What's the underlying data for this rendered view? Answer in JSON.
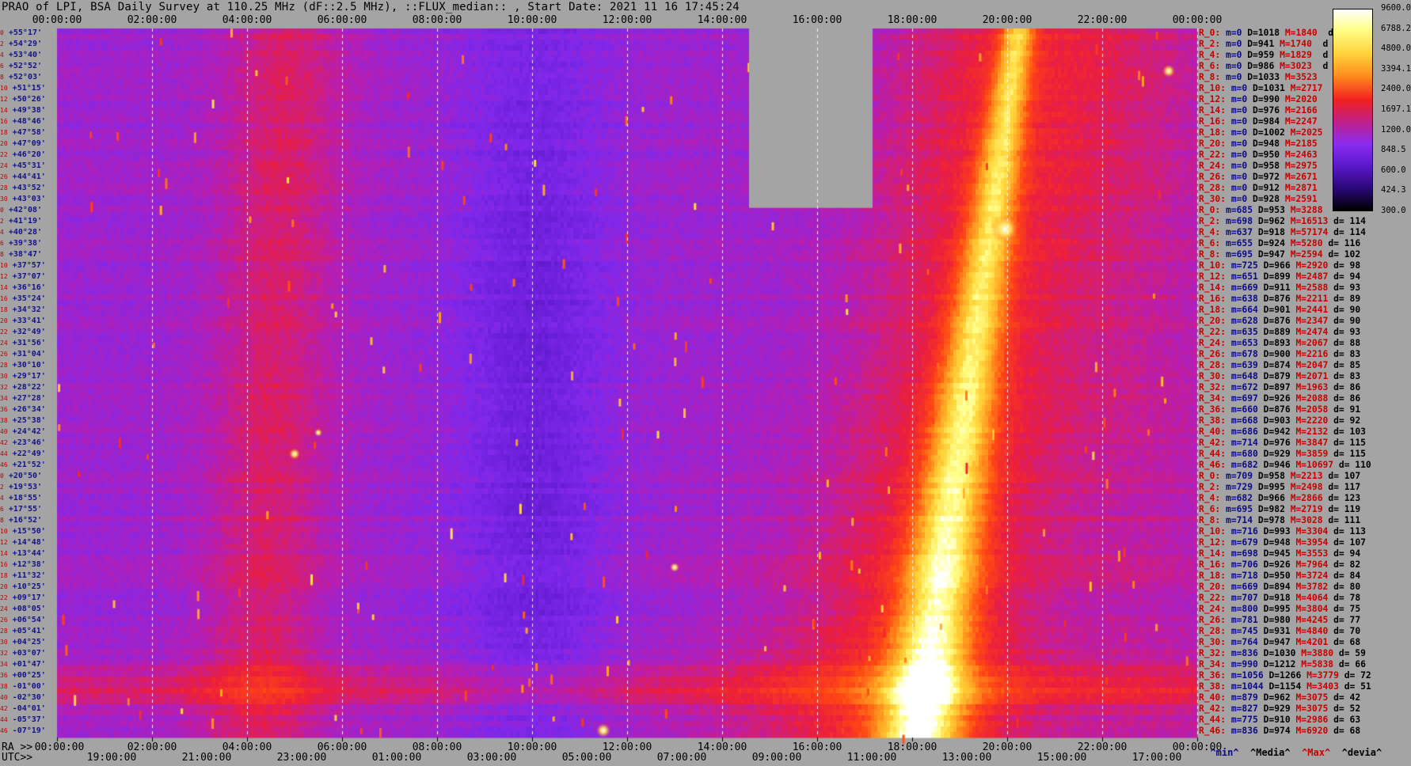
{
  "title": "PRAO of LPI, BSA Daily Survey at 110.25 MHz (dF::2.5 MHz), ::FLUX_median:: , Start Date: 2021 11 16 17:45:24",
  "axis": {
    "top_ticks": [
      "00:00:00",
      "02:00:00",
      "04:00:00",
      "06:00:00",
      "08:00:00",
      "10:00:00",
      "12:00:00",
      "14:00:00",
      "16:00:00",
      "18:00:00",
      "20:00:00",
      "22:00:00",
      "00:00:00"
    ],
    "bottom_ra_prefix": "RA >>",
    "bottom_ra_ticks": [
      "00:00:00",
      "02:00:00",
      "04:00:00",
      "06:00:00",
      "08:00:00",
      "10:00:00",
      "12:00:00",
      "14:00:00",
      "16:00:00",
      "18:00:00",
      "20:00:00",
      "22:00:00",
      "00:00:00"
    ],
    "bottom_utc_prefix": "UTC>>",
    "bottom_utc_ticks": [
      "19:00:00",
      "21:00:00",
      "23:00:00",
      "01:00:00",
      "03:00:00",
      "05:00:00",
      "07:00:00",
      "09:00:00",
      "11:00:00",
      "13:00:00",
      "15:00:00",
      "17:00:00"
    ]
  },
  "declinations": [
    "+55°17'",
    "+54°29'",
    "+53°40'",
    "+52°52'",
    "+52°03'",
    "+51°15'",
    "+50°26'",
    "+49°38'",
    "+48°46'",
    "+47°58'",
    "+47°09'",
    "+46°20'",
    "+45°31'",
    "+44°41'",
    "+43°52'",
    "+43°03'",
    "+42°08'",
    "+41°19'",
    "+40°28'",
    "+39°38'",
    "+38°47'",
    "+37°57'",
    "+37°07'",
    "+36°16'",
    "+35°24'",
    "+34°32'",
    "+33°41'",
    "+32°49'",
    "+31°56'",
    "+31°04'",
    "+30°10'",
    "+29°17'",
    "+28°22'",
    "+27°28'",
    "+26°34'",
    "+25°38'",
    "+24°42'",
    "+23°46'",
    "+22°49'",
    "+21°52'",
    "+20°50'",
    "+19°53'",
    "+18°55'",
    "+17°55'",
    "+16°52'",
    "+15°50'",
    "+14°48'",
    "+13°44'",
    "+12°38'",
    "+11°32'",
    "+10°25'",
    "+09°17'",
    "+08°05'",
    "+06°54'",
    "+05°41'",
    "+04°25'",
    "+03°07'",
    "+01°47'",
    "+00°25'",
    "-01°00'",
    "-02°30'",
    "-04°01'",
    "-05°37'",
    "-07°19'"
  ],
  "dec_index": [
    "0",
    "2",
    "4",
    "6",
    "8",
    "10",
    "12",
    "14",
    "16",
    "18",
    "20",
    "22",
    "24",
    "26",
    "28",
    "30",
    "0",
    "2",
    "4",
    "6",
    "8",
    "10",
    "12",
    "14",
    "16",
    "18",
    "20",
    "22",
    "24",
    "26",
    "28",
    "30",
    "32",
    "34",
    "36",
    "38",
    "40",
    "42",
    "44",
    "46",
    "0",
    "2",
    "4",
    "6",
    "8",
    "10",
    "12",
    "14",
    "16",
    "18",
    "20",
    "22",
    "24",
    "26",
    "28",
    "30",
    "32",
    "34",
    "36",
    "38",
    "40",
    "42",
    "44",
    "46"
  ],
  "stats": [
    {
      "r": "R_0:",
      "m": "m=0",
      "d": "D=1018",
      "mx": "M=1840",
      "dv": " d"
    },
    {
      "r": "R_2:",
      "m": "m=0",
      "d": "D=941",
      "mx": "M=1740",
      "dv": " d"
    },
    {
      "r": "R_4:",
      "m": "m=0",
      "d": "D=959",
      "mx": "M=1829",
      "dv": " d"
    },
    {
      "r": "R_6:",
      "m": "m=0",
      "d": "D=986",
      "mx": "M=3023",
      "dv": " d"
    },
    {
      "r": "R_8:",
      "m": "m=0",
      "d": "D=1033",
      "mx": "M=3523",
      "dv": ""
    },
    {
      "r": "R_10:",
      "m": "m=0",
      "d": "D=1031",
      "mx": "M=2717",
      "dv": ""
    },
    {
      "r": "R_12:",
      "m": "m=0",
      "d": "D=990",
      "mx": "M=2020",
      "dv": ""
    },
    {
      "r": "R_14:",
      "m": "m=0",
      "d": "D=976",
      "mx": "M=2166",
      "dv": ""
    },
    {
      "r": "R_16:",
      "m": "m=0",
      "d": "D=984",
      "mx": "M=2247",
      "dv": ""
    },
    {
      "r": "R_18:",
      "m": "m=0",
      "d": "D=1002",
      "mx": "M=2025",
      "dv": ""
    },
    {
      "r": "R_20:",
      "m": "m=0",
      "d": "D=948",
      "mx": "M=2185",
      "dv": ""
    },
    {
      "r": "R_22:",
      "m": "m=0",
      "d": "D=950",
      "mx": "M=2463",
      "dv": ""
    },
    {
      "r": "R_24:",
      "m": "m=0",
      "d": "D=958",
      "mx": "M=2975",
      "dv": ""
    },
    {
      "r": "R_26:",
      "m": "m=0",
      "d": "D=972",
      "mx": "M=2671",
      "dv": ""
    },
    {
      "r": "R_28:",
      "m": "m=0",
      "d": "D=912",
      "mx": "M=2871",
      "dv": ""
    },
    {
      "r": "R_30:",
      "m": "m=0",
      "d": "D=928",
      "mx": "M=2591",
      "dv": ""
    },
    {
      "r": "R_0:",
      "m": "m=685",
      "d": "D=953",
      "mx": "M=3288",
      "dv": ""
    },
    {
      "r": "R_2:",
      "m": "m=698",
      "d": "D=962",
      "mx": "M=16513",
      "dv": "d= 114"
    },
    {
      "r": "R_4:",
      "m": "m=637",
      "d": "D=918",
      "mx": "M=57174",
      "dv": "d= 114"
    },
    {
      "r": "R_6:",
      "m": "m=655",
      "d": "D=924",
      "mx": "M=5280",
      "dv": "d= 116"
    },
    {
      "r": "R_8:",
      "m": "m=695",
      "d": "D=947",
      "mx": "M=2594",
      "dv": "d= 102"
    },
    {
      "r": "R_10:",
      "m": "m=725",
      "d": "D=966",
      "mx": "M=2920",
      "dv": "d= 98"
    },
    {
      "r": "R_12:",
      "m": "m=651",
      "d": "D=899",
      "mx": "M=2487",
      "dv": "d= 94"
    },
    {
      "r": "R_14:",
      "m": "m=669",
      "d": "D=911",
      "mx": "M=2588",
      "dv": "d= 93"
    },
    {
      "r": "R_16:",
      "m": "m=638",
      "d": "D=876",
      "mx": "M=2211",
      "dv": "d= 89"
    },
    {
      "r": "R_18:",
      "m": "m=664",
      "d": "D=901",
      "mx": "M=2441",
      "dv": "d= 90"
    },
    {
      "r": "R_20:",
      "m": "m=628",
      "d": "D=876",
      "mx": "M=2347",
      "dv": "d= 90"
    },
    {
      "r": "R_22:",
      "m": "m=635",
      "d": "D=889",
      "mx": "M=2474",
      "dv": "d= 93"
    },
    {
      "r": "R_24:",
      "m": "m=653",
      "d": "D=893",
      "mx": "M=2067",
      "dv": "d= 88"
    },
    {
      "r": "R_26:",
      "m": "m=678",
      "d": "D=900",
      "mx": "M=2216",
      "dv": "d= 83"
    },
    {
      "r": "R_28:",
      "m": "m=639",
      "d": "D=874",
      "mx": "M=2047",
      "dv": "d= 85"
    },
    {
      "r": "R_30:",
      "m": "m=648",
      "d": "D=879",
      "mx": "M=2071",
      "dv": "d= 83"
    },
    {
      "r": "R_32:",
      "m": "m=672",
      "d": "D=897",
      "mx": "M=1963",
      "dv": "d= 86"
    },
    {
      "r": "R_34:",
      "m": "m=697",
      "d": "D=926",
      "mx": "M=2088",
      "dv": "d= 86"
    },
    {
      "r": "R_36:",
      "m": "m=660",
      "d": "D=876",
      "mx": "M=2058",
      "dv": "d= 91"
    },
    {
      "r": "R_38:",
      "m": "m=668",
      "d": "D=903",
      "mx": "M=2220",
      "dv": "d= 92"
    },
    {
      "r": "R_40:",
      "m": "m=686",
      "d": "D=942",
      "mx": "M=2132",
      "dv": "d= 103"
    },
    {
      "r": "R_42:",
      "m": "m=714",
      "d": "D=976",
      "mx": "M=3847",
      "dv": "d= 115"
    },
    {
      "r": "R_44:",
      "m": "m=680",
      "d": "D=929",
      "mx": "M=3859",
      "dv": "d= 115"
    },
    {
      "r": "R_46:",
      "m": "m=682",
      "d": "D=946",
      "mx": "M=10697",
      "dv": "d= 110"
    },
    {
      "r": "R_0:",
      "m": "m=709",
      "d": "D=958",
      "mx": "M=2213",
      "dv": "d= 107"
    },
    {
      "r": "R_2:",
      "m": "m=729",
      "d": "D=995",
      "mx": "M=2498",
      "dv": "d= 117"
    },
    {
      "r": "R_4:",
      "m": "m=682",
      "d": "D=966",
      "mx": "M=2866",
      "dv": "d= 123"
    },
    {
      "r": "R_6:",
      "m": "m=695",
      "d": "D=982",
      "mx": "M=2719",
      "dv": "d= 119"
    },
    {
      "r": "R_8:",
      "m": "m=714",
      "d": "D=978",
      "mx": "M=3028",
      "dv": "d= 111"
    },
    {
      "r": "R_10:",
      "m": "m=716",
      "d": "D=993",
      "mx": "M=3304",
      "dv": "d= 113"
    },
    {
      "r": "R_12:",
      "m": "m=679",
      "d": "D=948",
      "mx": "M=3954",
      "dv": "d= 107"
    },
    {
      "r": "R_14:",
      "m": "m=698",
      "d": "D=945",
      "mx": "M=3553",
      "dv": "d= 94"
    },
    {
      "r": "R_16:",
      "m": "m=706",
      "d": "D=926",
      "mx": "M=7964",
      "dv": "d= 82"
    },
    {
      "r": "R_18:",
      "m": "m=718",
      "d": "D=950",
      "mx": "M=3724",
      "dv": "d= 84"
    },
    {
      "r": "R_20:",
      "m": "m=669",
      "d": "D=894",
      "mx": "M=3782",
      "dv": "d= 80"
    },
    {
      "r": "R_22:",
      "m": "m=707",
      "d": "D=918",
      "mx": "M=4064",
      "dv": "d= 78"
    },
    {
      "r": "R_24:",
      "m": "m=800",
      "d": "D=995",
      "mx": "M=3804",
      "dv": "d= 75"
    },
    {
      "r": "R_26:",
      "m": "m=781",
      "d": "D=980",
      "mx": "M=4245",
      "dv": "d= 77"
    },
    {
      "r": "R_28:",
      "m": "m=745",
      "d": "D=931",
      "mx": "M=4840",
      "dv": "d= 70"
    },
    {
      "r": "R_30:",
      "m": "m=764",
      "d": "D=947",
      "mx": "M=4201",
      "dv": "d= 68"
    },
    {
      "r": "R_32:",
      "m": "m=836",
      "d": "D=1030",
      "mx": "M=3880",
      "dv": "d= 59"
    },
    {
      "r": "R_34:",
      "m": "m=990",
      "d": "D=1212",
      "mx": "M=5838",
      "dv": "d= 66"
    },
    {
      "r": "R_36:",
      "m": "m=1056",
      "d": "D=1266",
      "mx": "M=3779",
      "dv": "d= 72"
    },
    {
      "r": "R_38:",
      "m": "m=1044",
      "d": "D=1154",
      "mx": "M=3403",
      "dv": "d= 51"
    },
    {
      "r": "R_40:",
      "m": "m=879",
      "d": "D=962",
      "mx": "M=3075",
      "dv": "d= 42"
    },
    {
      "r": "R_42:",
      "m": "m=827",
      "d": "D=929",
      "mx": "M=3075",
      "dv": "d= 52"
    },
    {
      "r": "R_44:",
      "m": "m=775",
      "d": "D=910",
      "mx": "M=2986",
      "dv": "d= 63"
    },
    {
      "r": "R_46:",
      "m": "m=836",
      "d": "D=974",
      "mx": "M=6920",
      "dv": "d= 68"
    }
  ],
  "colorbar": {
    "labels": [
      "9600.0",
      "6788.2",
      "4800.0",
      "3394.1",
      "2400.0",
      "1697.1",
      "1200.0",
      "848.5",
      "600.0",
      "424.3",
      "300.0"
    ]
  },
  "legend": {
    "min": "^min^",
    "median": "^Media^",
    "max": "^Max^",
    "dev": "^devia^"
  },
  "colors": {
    "background": "#a4a4a4",
    "low": "#5a18c8",
    "mid": "#f02020",
    "high": "#ffff88"
  },
  "chart_data": {
    "type": "heatmap",
    "title": "PRAO of LPI, BSA Daily Survey at 110.25 MHz (dF::2.5 MHz), ::FLUX_median:: , Start Date: 2021 11 16 17:45:24",
    "xlabel": "RA",
    "xlim": [
      "00:00:00",
      "24:00:00"
    ],
    "ylim": [
      "-07°19'",
      "+55°17'"
    ],
    "color_scale": "log",
    "color_range": [
      300.0,
      9600.0
    ],
    "data_gap": {
      "ra_start": "14:30:00",
      "ra_end": "17:10:00",
      "dec_top": "+55°17'",
      "dec_bottom": "+42°08'"
    }
  }
}
